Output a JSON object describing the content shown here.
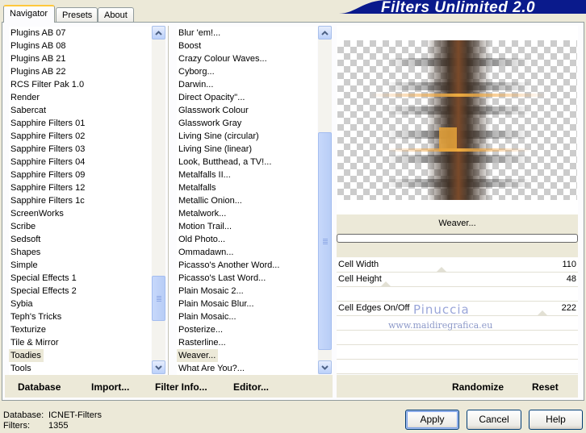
{
  "tabs": [
    {
      "label": "Navigator",
      "active": true
    },
    {
      "label": "Presets",
      "active": false
    },
    {
      "label": "About",
      "active": false
    }
  ],
  "banner": {
    "title": "Filters Unlimited 2.0",
    "color": "#0A1A8C"
  },
  "categories": {
    "items": [
      "Plugins AB 07",
      "Plugins AB 08",
      "Plugins AB 21",
      "Plugins AB 22",
      "RCS Filter Pak 1.0",
      "Render",
      "Sabercat",
      "Sapphire Filters 01",
      "Sapphire Filters 02",
      "Sapphire Filters 03",
      "Sapphire Filters 04",
      "Sapphire Filters 09",
      "Sapphire Filters 12",
      "Sapphire Filters 1c",
      "ScreenWorks",
      "Scribe",
      "Sedsoft",
      "Shapes",
      "Simple",
      "Special Effects 1",
      "Special Effects 2",
      "Sybia",
      "Teph's Tricks",
      "Texturize",
      "Tile & Mirror",
      "Toadies",
      "Tools"
    ],
    "selected": "Toadies"
  },
  "filters": {
    "items": [
      "Blur 'em!...",
      "Boost",
      "Crazy Colour Waves...",
      "Cyborg...",
      "Darwin...",
      "Direct Opacity''...",
      "Glasswork Colour",
      "Glasswork Gray",
      "Living Sine (circular)",
      "Living Sine (linear)",
      "Look, Butthead, a TV!...",
      "Metalfalls II...",
      "Metalfalls",
      "Metallic Onion...",
      "Metalwork...",
      "Motion Trail...",
      "Old Photo...",
      "Ommadawn...",
      "Picasso's Another Word...",
      "Picasso's Last Word...",
      "Plain Mosaic 2...",
      "Plain Mosaic Blur...",
      "Plain Mosaic...",
      "Posterize...",
      "Rasterline...",
      "Weaver...",
      "What Are You?..."
    ],
    "selected": "Weaver..."
  },
  "preview": {
    "filter_name": "Weaver...",
    "progress_percent": 0
  },
  "params": [
    {
      "label": "Cell Width",
      "value": "110",
      "level": 0.43
    },
    {
      "label": "Cell Height",
      "value": "48",
      "level": 0.19
    },
    {
      "label": "",
      "value": "",
      "level": 0
    },
    {
      "label": "Cell Edges On/Off",
      "value": "222",
      "level": 0.87
    },
    {
      "label": "",
      "value": "",
      "level": 0
    },
    {
      "label": "",
      "value": "",
      "level": 0
    },
    {
      "label": "",
      "value": "",
      "level": 0
    },
    {
      "label": "",
      "value": "",
      "level": 0
    }
  ],
  "watermark": {
    "line1": "Pinuccia",
    "line2": "www.maidiregrafica.eu"
  },
  "left_toolbar": {
    "database": "Database",
    "import": "Import...",
    "filter_info": "Filter Info...",
    "editor": "Editor..."
  },
  "right_toolbar": {
    "randomize": "Randomize",
    "reset": "Reset"
  },
  "status": {
    "database_label": "Database:",
    "database_value": "ICNET-Filters",
    "filters_label": "Filters:",
    "filters_value": "1355"
  },
  "buttons": {
    "apply": "Apply",
    "cancel": "Cancel",
    "help": "Help"
  }
}
